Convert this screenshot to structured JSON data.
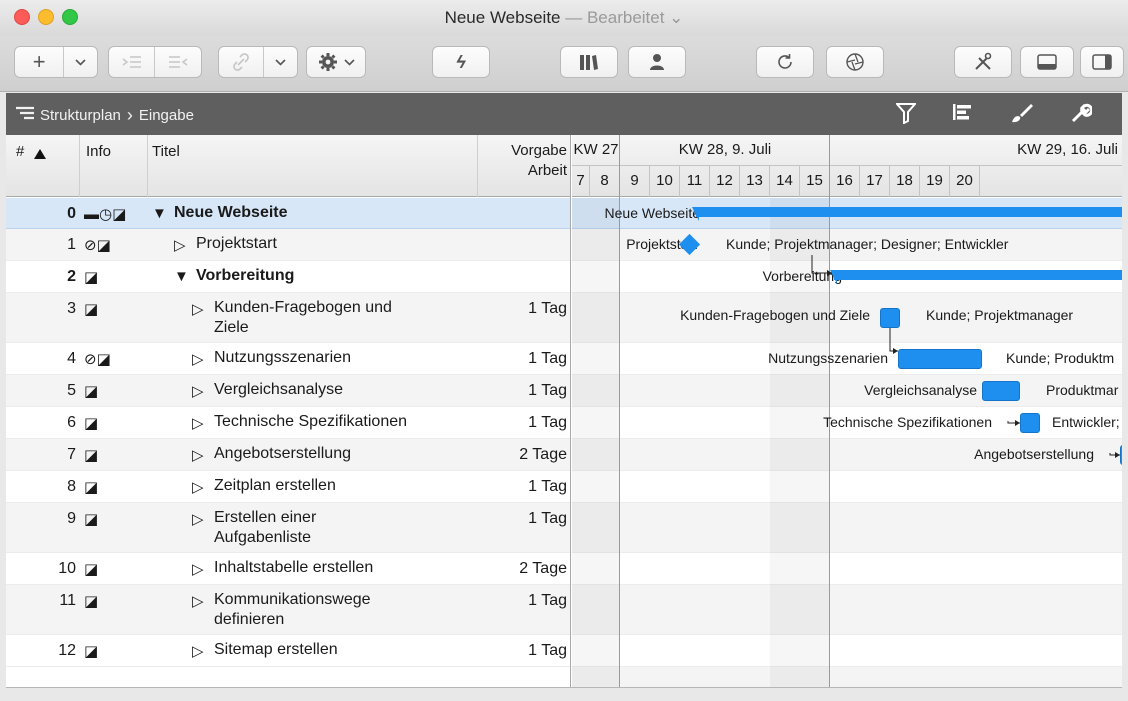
{
  "window": {
    "title": "Neue Webseite",
    "title_suffix": "— Bearbeitet ⌄"
  },
  "toolbar": {
    "add_icon": "+",
    "chevron": "⌄",
    "bolt_icon": "ϟ",
    "sync_icon": "⟳"
  },
  "breadcrumb": {
    "root": "Strukturplan",
    "separator": "›",
    "current": "Eingabe"
  },
  "columns": {
    "num": "#",
    "info": "Info",
    "title": "Titel",
    "effort_line1": "Vorgabe",
    "effort_line2": "Arbeit"
  },
  "timeline": {
    "weeks": [
      "KW 27",
      "KW 28, 9. Juli",
      "KW 29, 16. Juli"
    ],
    "days": [
      "7",
      "8",
      "9",
      "10",
      "11",
      "12",
      "13",
      "14",
      "15",
      "16",
      "17",
      "18",
      "19",
      "20"
    ]
  },
  "rows": [
    {
      "num": "0",
      "info": "▬◷◪",
      "title": "Neue Webseite",
      "marker": "▼",
      "effort": "",
      "bold": true,
      "indent": 0
    },
    {
      "num": "1",
      "info": "⊘◪",
      "title": "Projektstart",
      "marker": "▷",
      "effort": "",
      "bold": false,
      "indent": 1
    },
    {
      "num": "2",
      "info": "◪",
      "title": "Vorbereitung",
      "marker": "▼",
      "effort": "",
      "bold": true,
      "indent": 1
    },
    {
      "num": "3",
      "info": "◪",
      "title": "Kunden-Fragebogen und",
      "title2": "Ziele",
      "marker": "▷",
      "effort": "1 Tag",
      "bold": false,
      "indent": 2
    },
    {
      "num": "4",
      "info": "⊘◪",
      "title": "Nutzungsszenarien",
      "marker": "▷",
      "effort": "1 Tag",
      "bold": false,
      "indent": 2
    },
    {
      "num": "5",
      "info": "◪",
      "title": "Vergleichsanalyse",
      "marker": "▷",
      "effort": "1 Tag",
      "bold": false,
      "indent": 2
    },
    {
      "num": "6",
      "info": "◪",
      "title": "Technische Spezifikationen",
      "marker": "▷",
      "effort": "1 Tag",
      "bold": false,
      "indent": 2
    },
    {
      "num": "7",
      "info": "◪",
      "title": "Angebotserstellung",
      "marker": "▷",
      "effort": "2 Tage",
      "bold": false,
      "indent": 2
    },
    {
      "num": "8",
      "info": "◪",
      "title": "Zeitplan erstellen",
      "marker": "▷",
      "effort": "1 Tag",
      "bold": false,
      "indent": 2
    },
    {
      "num": "9",
      "info": "◪",
      "title": "Erstellen einer",
      "title2": "Aufgabenliste",
      "marker": "▷",
      "effort": "1 Tag",
      "bold": false,
      "indent": 2
    },
    {
      "num": "10",
      "info": "◪",
      "title": "Inhaltstabelle erstellen",
      "marker": "▷",
      "effort": "2 Tage",
      "bold": false,
      "indent": 2
    },
    {
      "num": "11",
      "info": "◪",
      "title": "Kommunikationswege",
      "title2": "definieren",
      "marker": "▷",
      "effort": "1 Tag",
      "bold": false,
      "indent": 2
    },
    {
      "num": "12",
      "info": "◪",
      "title": "Sitemap erstellen",
      "marker": "▷",
      "effort": "1 Tag",
      "bold": false,
      "indent": 2
    }
  ],
  "gantt_labels": {
    "r0_left": "Neue Webseite",
    "r1_left": "Projektstart",
    "r1_right": "Kunde; Projektmanager; Designer; Entwickler",
    "r2_left": "Vorbereitung",
    "r3_left": "Kunden-Fragebogen und Ziele",
    "r3_right": "Kunde; Projektmanager",
    "r4_left": "Nutzungsszenarien",
    "r4_right": "Kunde; Produktm",
    "r5_left": "Vergleichsanalyse",
    "r5_right": "Produktmar",
    "r6_left": "Technische Spezifikationen",
    "r6_right": "Entwickler;",
    "r7_left": "Angebotserstellung"
  },
  "colors": {
    "bar": "#1e8fef",
    "selection": "#d7e7f8"
  }
}
